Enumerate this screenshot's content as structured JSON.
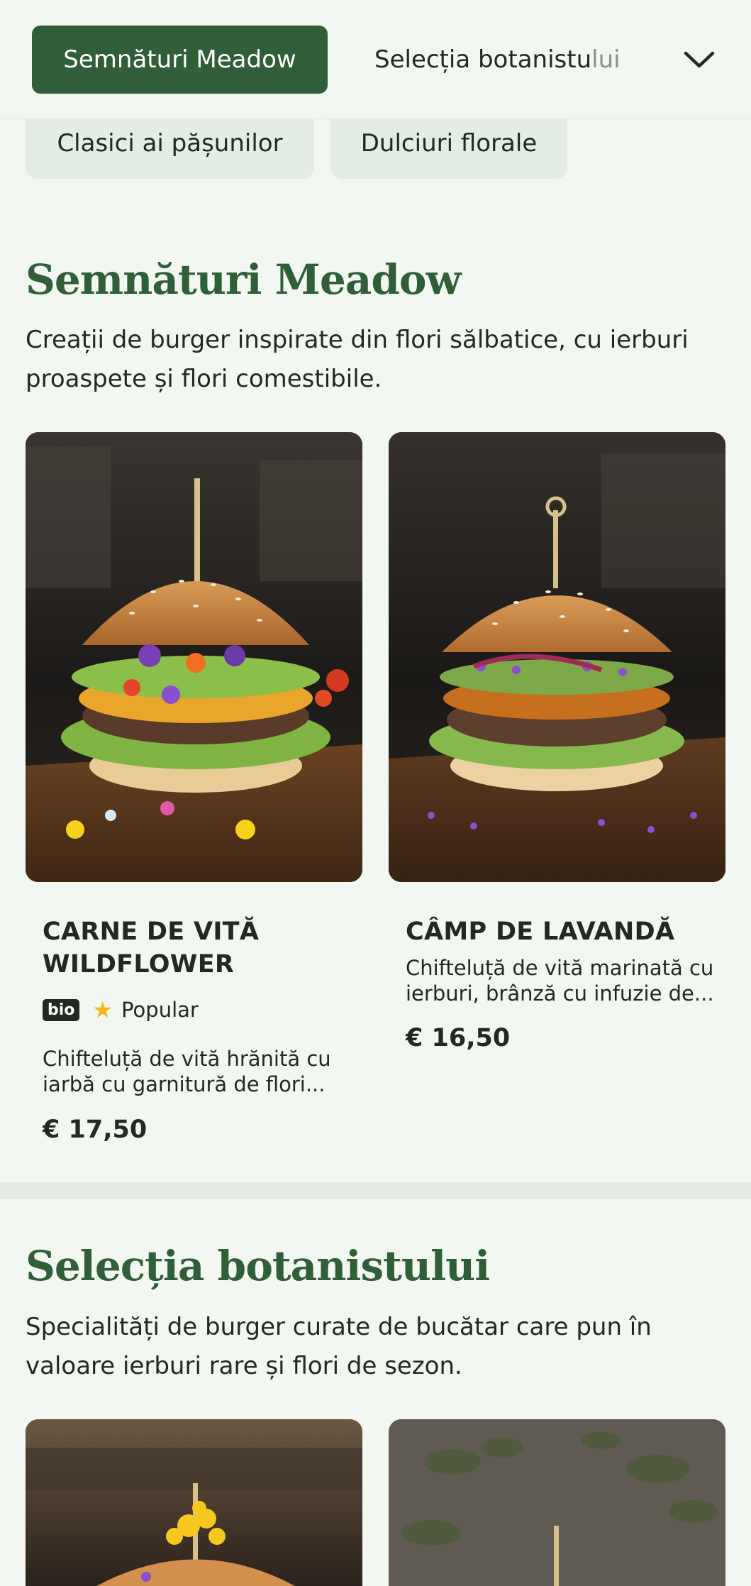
{
  "category_nav": {
    "active": "Semnături Meadow",
    "next_visible": "Selecția botanistu",
    "next_faded": "lui",
    "chips": [
      "Clasici ai pășunilor",
      "Dulciuri florale"
    ]
  },
  "sections": [
    {
      "title": "Semnături Meadow",
      "description": "Creații de burger inspirate din flori sălbatice, cu ierburi proaspete și flori comestibile.",
      "items": [
        {
          "name_line1": "CARNE DE VITĂ",
          "name_line2": "WILDFLOWER",
          "bio_badge": "bio",
          "tag": "Popular",
          "desc_line1": "Chifteluță de vită hrănită cu",
          "desc_line2": "iarbă cu garnitură de flori...",
          "price": "€ 17,50"
        },
        {
          "name": "CÂMP DE LAVANDĂ",
          "desc_line1": "Chifteluță de vită marinată cu",
          "desc_line2": "ierburi, brânză cu infuzie de...",
          "price": "€ 16,50"
        }
      ]
    },
    {
      "title": "Selecția botanistului",
      "description": "Specialități de burger curate de bucătar care pun în valoare ierburi rare și flori de sezon."
    }
  ],
  "colors": {
    "brand_green": "#2f5e38",
    "background": "#f2f7f1",
    "chip_bg": "#e4ede3",
    "star": "#f2b71c"
  },
  "icons": {
    "dropdown": "chevron-down-icon",
    "popular": "star-icon"
  }
}
